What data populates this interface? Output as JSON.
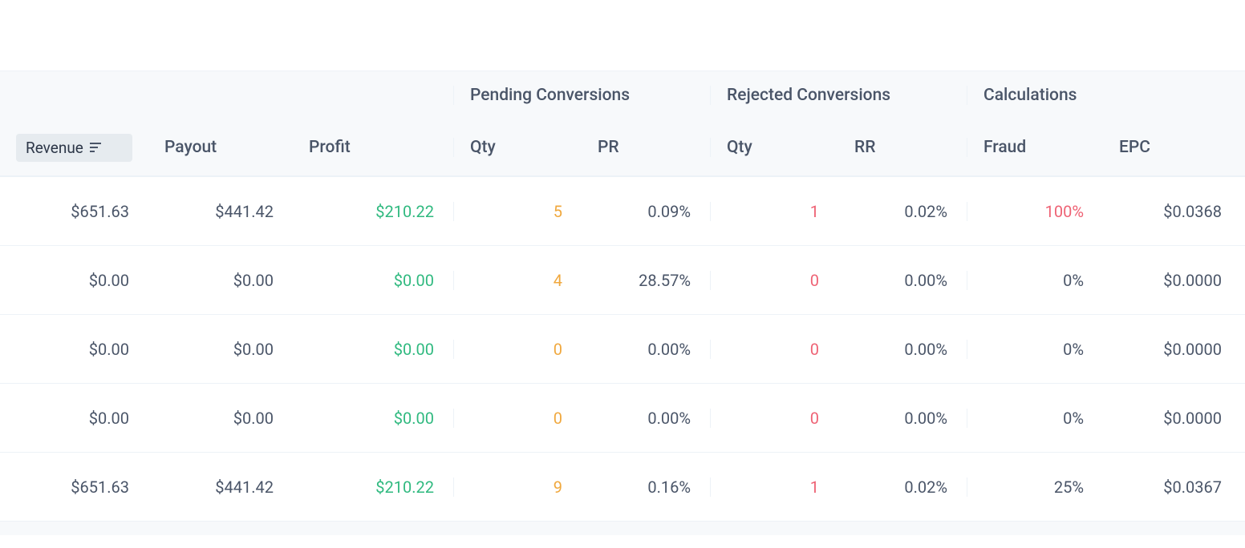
{
  "table": {
    "groups": {
      "pending": "Pending Conversions",
      "rejected": "Rejected Conversions",
      "calculations": "Calculations"
    },
    "columns": {
      "revenue": "Revenue",
      "payout": "Payout",
      "profit": "Profit",
      "pending_qty": "Qty",
      "pending_pr": "PR",
      "rejected_qty": "Qty",
      "rejected_rr": "RR",
      "fraud": "Fraud",
      "epc": "EPC"
    },
    "rows": [
      {
        "revenue": "$651.63",
        "payout": "$441.42",
        "profit": "$210.22",
        "pending_qty": "5",
        "pending_pr": "0.09%",
        "rejected_qty": "1",
        "rejected_rr": "0.02%",
        "fraud": "100%",
        "fraud_red": true,
        "epc": "$0.0368"
      },
      {
        "revenue": "$0.00",
        "payout": "$0.00",
        "profit": "$0.00",
        "pending_qty": "4",
        "pending_pr": "28.57%",
        "rejected_qty": "0",
        "rejected_rr": "0.00%",
        "fraud": "0%",
        "fraud_red": false,
        "epc": "$0.0000"
      },
      {
        "revenue": "$0.00",
        "payout": "$0.00",
        "profit": "$0.00",
        "pending_qty": "0",
        "pending_pr": "0.00%",
        "rejected_qty": "0",
        "rejected_rr": "0.00%",
        "fraud": "0%",
        "fraud_red": false,
        "epc": "$0.0000"
      },
      {
        "revenue": "$0.00",
        "payout": "$0.00",
        "profit": "$0.00",
        "pending_qty": "0",
        "pending_pr": "0.00%",
        "rejected_qty": "0",
        "rejected_rr": "0.00%",
        "fraud": "0%",
        "fraud_red": false,
        "epc": "$0.0000"
      },
      {
        "revenue": "$651.63",
        "payout": "$441.42",
        "profit": "$210.22",
        "pending_qty": "9",
        "pending_pr": "0.16%",
        "rejected_qty": "1",
        "rejected_rr": "0.02%",
        "fraud": "25%",
        "fraud_red": false,
        "epc": "$0.0367"
      }
    ]
  }
}
